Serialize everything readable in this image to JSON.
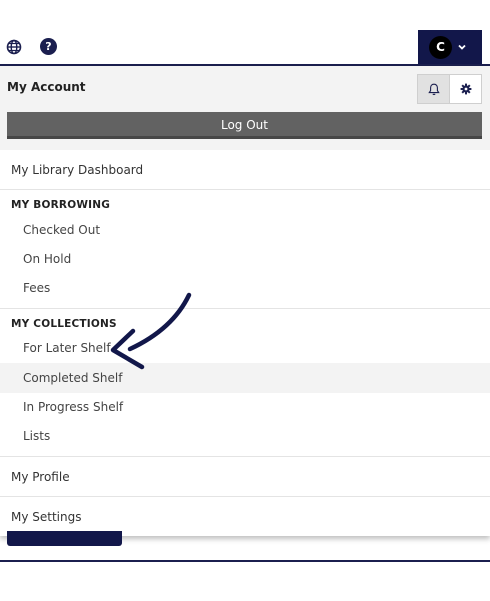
{
  "header": {
    "avatar_initial": "C",
    "icons": {
      "language": "globe-icon",
      "help": "question-circle-icon",
      "menu": "chevron-down-icon"
    },
    "help_glyph": "?"
  },
  "account": {
    "title": "My Account",
    "logout_label": "Log Out",
    "icons": {
      "notifications": "bell-icon",
      "settings": "gear-icon"
    }
  },
  "menu": {
    "dashboard": "My Library Dashboard",
    "borrowing": {
      "heading": "MY BORROWING",
      "items": [
        "Checked Out",
        "On Hold",
        "Fees"
      ]
    },
    "collections": {
      "heading": "MY COLLECTIONS",
      "items": [
        "For Later Shelf",
        "Completed Shelf",
        "In Progress Shelf",
        "Lists"
      ]
    },
    "profile": "My Profile",
    "settings": "My Settings"
  },
  "colors": {
    "brand": "#12174a",
    "logout": "#626262",
    "hover": "#f3f3f3"
  }
}
